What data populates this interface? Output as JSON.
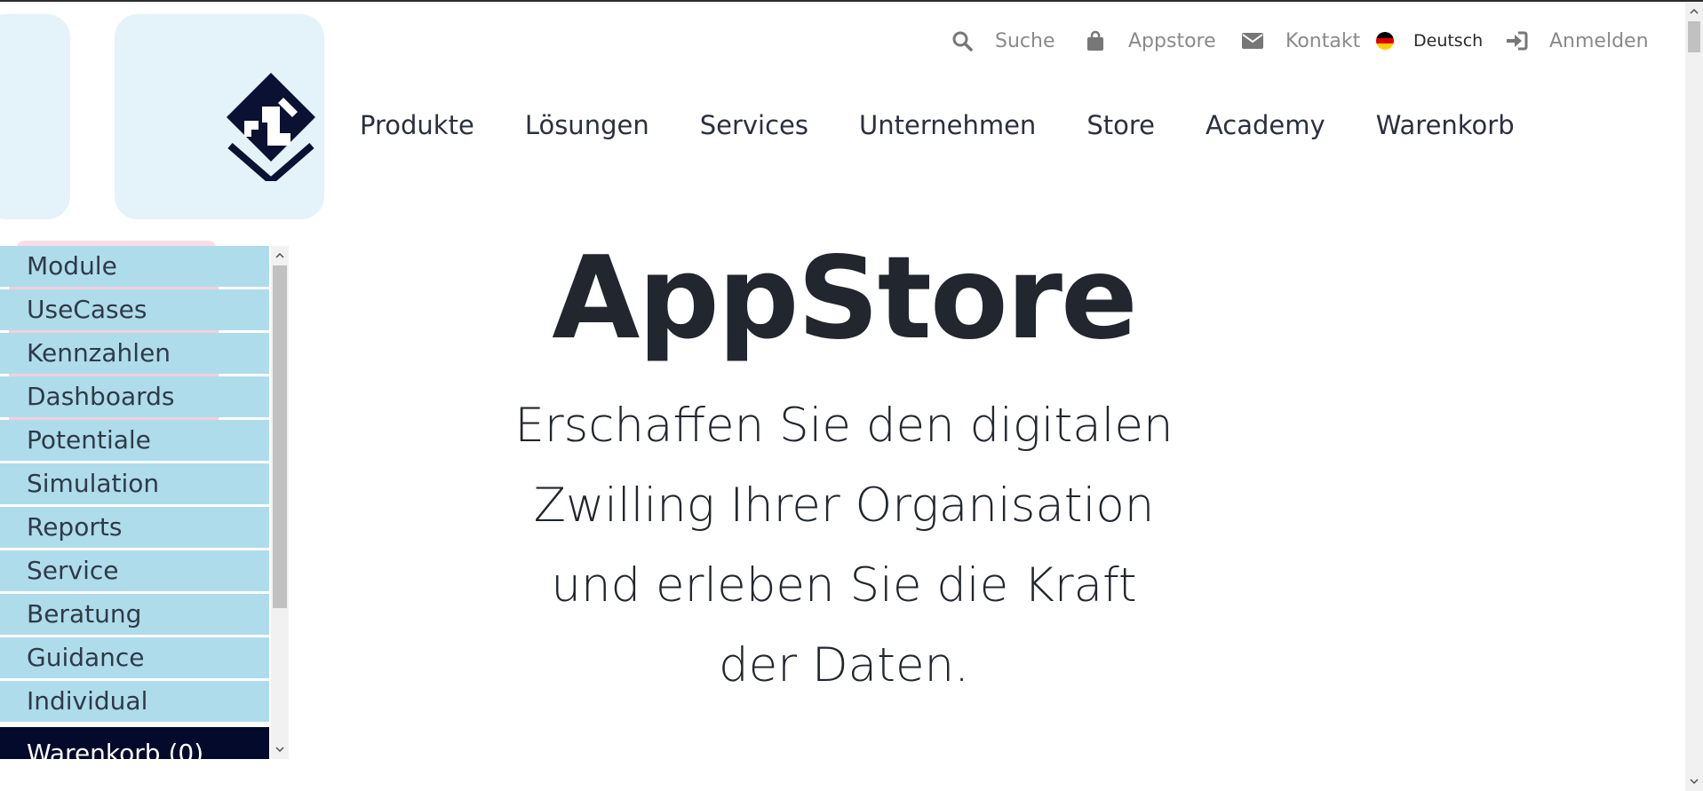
{
  "utility_nav": {
    "search_label": "Suche",
    "appstore_label": "Appstore",
    "contact_label": "Kontakt",
    "language_label": "Deutsch",
    "login_label": "Anmelden",
    "icons": [
      "search-icon",
      "shopping-bag-icon",
      "envelope-icon",
      "german-flag-icon",
      "sign-in-icon"
    ]
  },
  "main_nav": {
    "items": [
      "Produkte",
      "Lösungen",
      "Services",
      "Unternehmen",
      "Store",
      "Academy",
      "Warenkorb"
    ]
  },
  "hero": {
    "title": "AppStore",
    "subtitle_lines": [
      "Erschaffen Sie den digitalen",
      "Zwilling Ihrer Organisation",
      "und erleben Sie die Kraft",
      "der Daten."
    ]
  },
  "side_menu": {
    "items": [
      "Module",
      "UseCases",
      "Kennzahlen",
      "Dashboards",
      "Potentiale",
      "Simulation",
      "Reports",
      "Service",
      "Beratung",
      "Guidance",
      "Individual"
    ],
    "cart_label": "Warenkorb (0)"
  },
  "colors": {
    "menu_bg": "#afdceb",
    "cart_bg": "#040a2c",
    "tile_bg": "#e4f2f9",
    "logo": "#0b1133",
    "text_dark": "#22262e",
    "util_text": "#8a8a8a"
  }
}
